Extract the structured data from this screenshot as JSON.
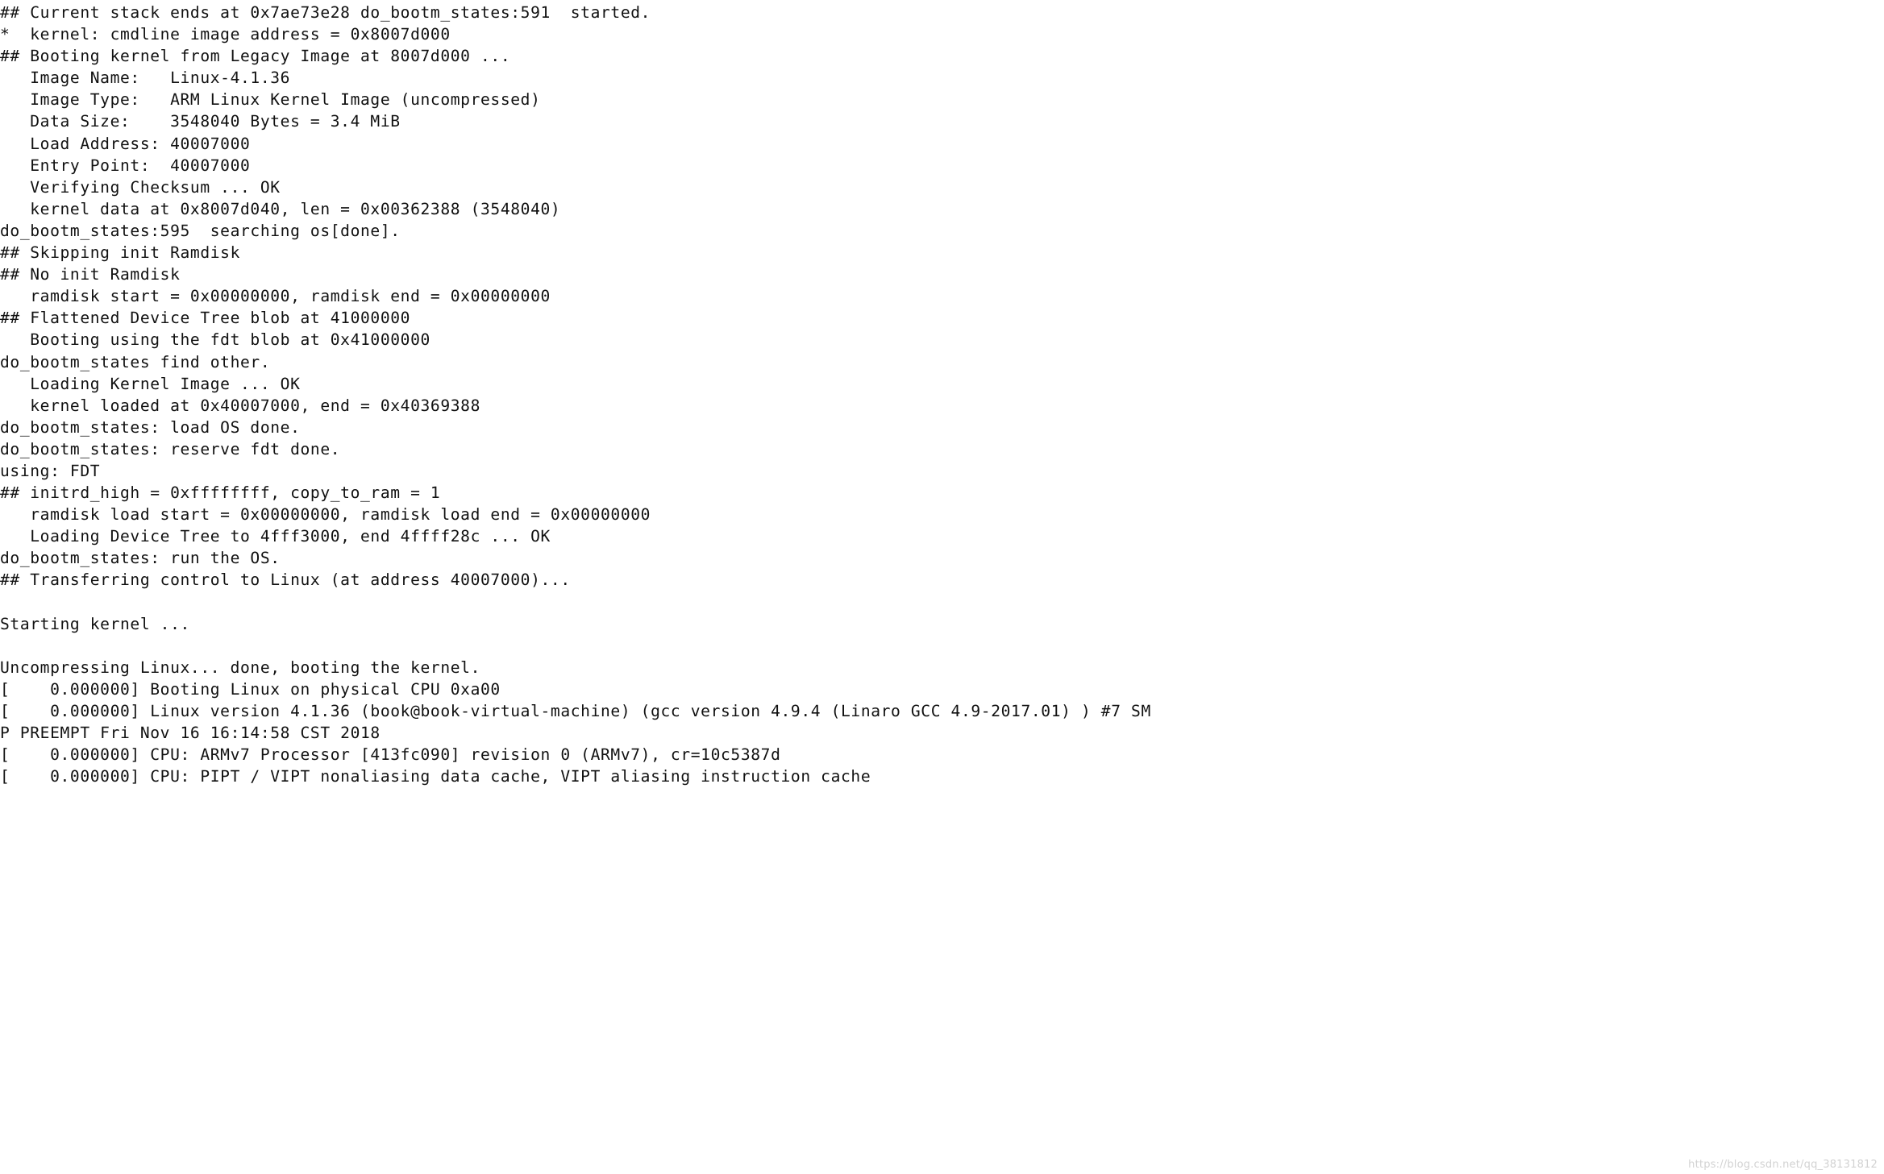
{
  "console": {
    "title": "U-Boot and Linux kernel boot console output",
    "background_color": "#ffffff",
    "text_color": "#111111",
    "watermark": "https://blog.csdn.net/qq_38131812",
    "watermark_color": "#d2d2d2",
    "line_count": 36,
    "lines": [
      "## Current stack ends at 0x7ae73e28 do_bootm_states:591  started.",
      "*  kernel: cmdline image address = 0x8007d000",
      "## Booting kernel from Legacy Image at 8007d000 ...",
      "   Image Name:   Linux-4.1.36",
      "   Image Type:   ARM Linux Kernel Image (uncompressed)",
      "   Data Size:    3548040 Bytes = 3.4 MiB",
      "   Load Address: 40007000",
      "   Entry Point:  40007000",
      "   Verifying Checksum ... OK",
      "   kernel data at 0x8007d040, len = 0x00362388 (3548040)",
      "do_bootm_states:595  searching os[done].",
      "## Skipping init Ramdisk",
      "## No init Ramdisk",
      "   ramdisk start = 0x00000000, ramdisk end = 0x00000000",
      "## Flattened Device Tree blob at 41000000",
      "   Booting using the fdt blob at 0x41000000",
      "do_bootm_states find other.",
      "   Loading Kernel Image ... OK",
      "   kernel loaded at 0x40007000, end = 0x40369388",
      "do_bootm_states: load OS done.",
      "do_bootm_states: reserve fdt done.",
      "using: FDT",
      "## initrd_high = 0xffffffff, copy_to_ram = 1",
      "   ramdisk load start = 0x00000000, ramdisk load end = 0x00000000",
      "   Loading Device Tree to 4fff3000, end 4ffff28c ... OK",
      "do_bootm_states: run the OS.",
      "## Transferring control to Linux (at address 40007000)...",
      "",
      "Starting kernel ...",
      "",
      "Uncompressing Linux... done, booting the kernel.",
      "[    0.000000] Booting Linux on physical CPU 0xa00",
      "[    0.000000] Linux version 4.1.36 (book@book-virtual-machine) (gcc version 4.9.4 (Linaro GCC 4.9-2017.01) ) #7 SM",
      "P PREEMPT Fri Nov 16 16:14:58 CST 2018",
      "[    0.000000] CPU: ARMv7 Processor [413fc090] revision 0 (ARMv7), cr=10c5387d",
      "[    0.000000] CPU: PIPT / VIPT nonaliasing data cache, VIPT aliasing instruction cache"
    ]
  }
}
